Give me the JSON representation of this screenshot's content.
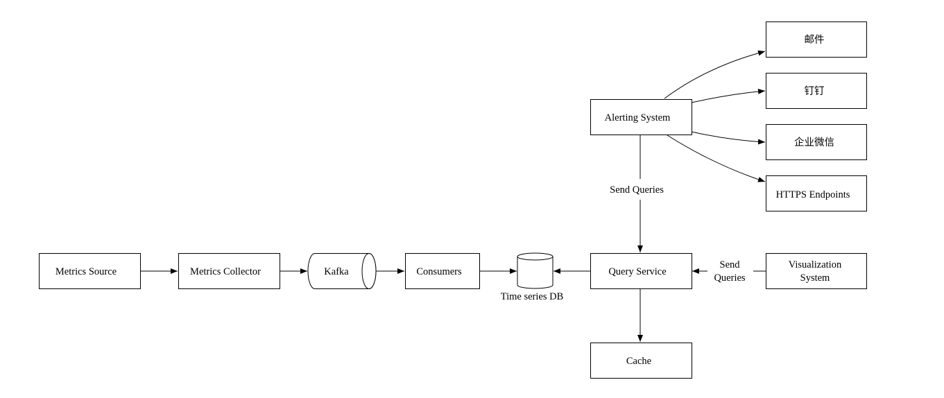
{
  "nodes": {
    "metrics_source": "Metrics Source",
    "metrics_collector": "Metrics Collector",
    "kafka": "Kafka",
    "consumers": "Consumers",
    "tsdb": "Time series DB",
    "query_service": "Query Service",
    "visualization": [
      "Visualization",
      "System"
    ],
    "cache": "Cache",
    "alerting": "Alerting System",
    "email": "邮件",
    "dingtalk": "钉钉",
    "wecom": "企业微信",
    "https": "HTTPS Endpoints"
  },
  "edges": {
    "alert_query_label": "Send Queries",
    "vis_query_label": [
      "Send",
      "Queries"
    ]
  }
}
